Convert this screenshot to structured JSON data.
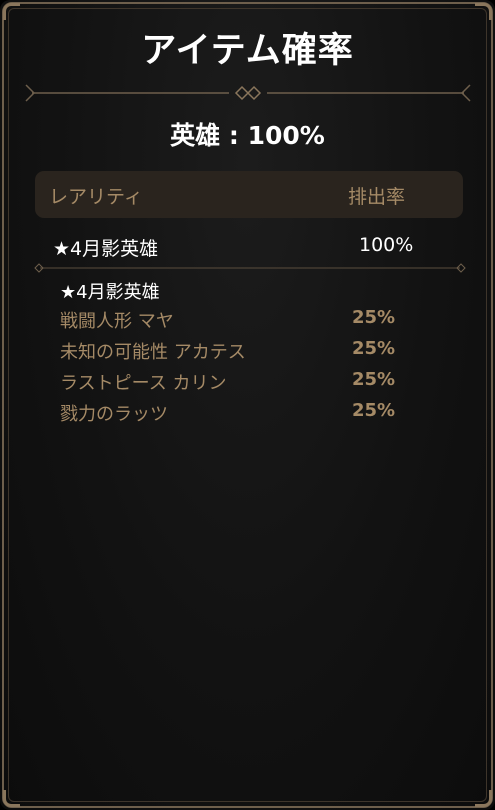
{
  "title": "アイテム確率",
  "summary": "英雄 : 100%",
  "table_header": {
    "rarity_label": "レアリティ",
    "rate_label": "排出率"
  },
  "group": {
    "label": "★4月影英雄",
    "rate": "100%"
  },
  "sub_heading": "★4月影英雄",
  "items": [
    {
      "name": "戦闘人形 マヤ",
      "rate": "25%"
    },
    {
      "name": "未知の可能性 アカテス",
      "rate": "25%"
    },
    {
      "name": "ラストピース カリン",
      "rate": "25%"
    },
    {
      "name": "戮力のラッツ",
      "rate": "25%"
    }
  ],
  "colors": {
    "accent_gold": "#a58a66",
    "frame": "#6e5f4c",
    "header_bg": "#2a241e",
    "text_white": "#ffffff"
  }
}
